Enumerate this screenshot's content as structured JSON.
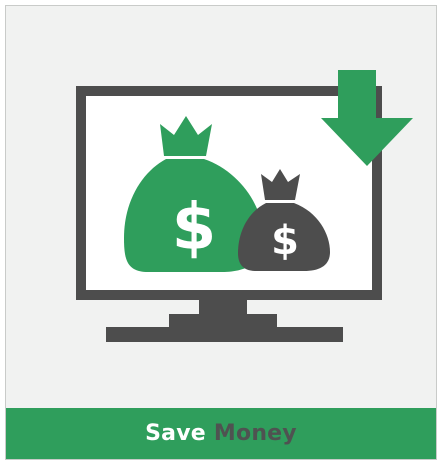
{
  "banner": {
    "word_1": "Save",
    "word_2": "Money"
  },
  "illustration": {
    "large_bag_symbol": "$",
    "small_bag_symbol": "$",
    "icons": [
      "monitor-icon",
      "money-bag-icon",
      "download-arrow-icon"
    ]
  },
  "colors": {
    "green": "#2f9e5c",
    "dark_gray": "#4d4d4d",
    "card_background": "#f1f2f1",
    "white": "#ffffff"
  }
}
